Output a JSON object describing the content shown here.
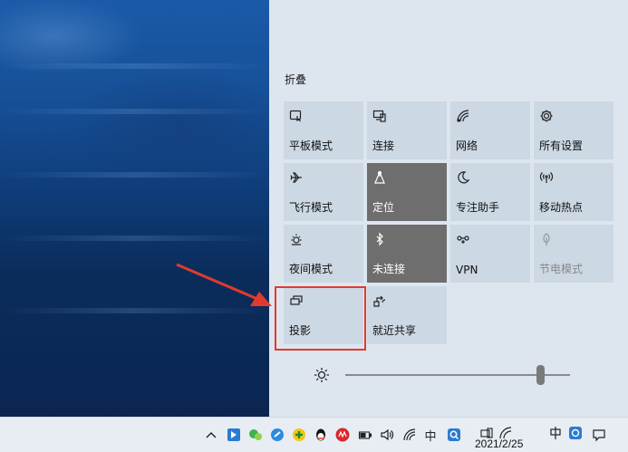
{
  "action_center": {
    "collapse_label": "折叠",
    "tiles": [
      {
        "label": "平板模式",
        "icon": "tablet-mode-icon",
        "state": "off"
      },
      {
        "label": "连接",
        "icon": "connect-icon",
        "state": "off"
      },
      {
        "label": "网络",
        "icon": "network-icon",
        "state": "off"
      },
      {
        "label": "所有设置",
        "icon": "settings-gear-icon",
        "state": "off"
      },
      {
        "label": "飞行模式",
        "icon": "airplane-icon",
        "state": "off"
      },
      {
        "label": "定位",
        "icon": "location-icon",
        "state": "on"
      },
      {
        "label": "专注助手",
        "icon": "moon-icon",
        "state": "off"
      },
      {
        "label": "移动热点",
        "icon": "hotspot-icon",
        "state": "off"
      },
      {
        "label": "夜间模式",
        "icon": "night-light-icon",
        "state": "off"
      },
      {
        "label": "未连接",
        "icon": "bluetooth-icon",
        "state": "on"
      },
      {
        "label": "VPN",
        "icon": "vpn-icon",
        "state": "off"
      },
      {
        "label": "节电模式",
        "icon": "battery-saver-icon",
        "state": "disabled"
      },
      {
        "label": "投影",
        "icon": "project-icon",
        "state": "off"
      },
      {
        "label": "就近共享",
        "icon": "nearby-share-icon",
        "state": "off"
      }
    ],
    "brightness": 0.87
  },
  "taskbar": {
    "clock_date": "2021/2/25",
    "ime_label": "中"
  },
  "colors": {
    "panel_bg": "#dde6ef",
    "tile_bg": "#ccd8e4",
    "tile_active_bg": "#6e6e6e",
    "highlight_red": "#e23a2e"
  }
}
